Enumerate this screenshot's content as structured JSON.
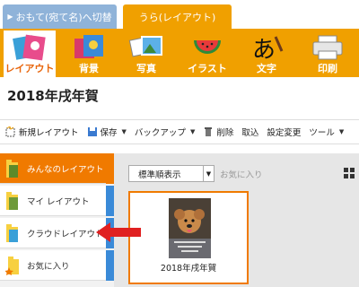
{
  "tabs": {
    "front_label": "おもて(宛て名)へ切替",
    "back_label": "うら(レイアウト)"
  },
  "categories": [
    {
      "label": "レイアウト",
      "active": true
    },
    {
      "label": "背景"
    },
    {
      "label": "写真"
    },
    {
      "label": "イラスト"
    },
    {
      "label": "文字"
    },
    {
      "label": "印刷"
    }
  ],
  "page_title": "2018年戌年賀",
  "toolbar": {
    "new_layout": "新規レイアウト",
    "save": "保存",
    "backup": "バックアップ",
    "delete": "削除",
    "import": "取込",
    "settings": "設定変更",
    "tools": "ツール"
  },
  "sidebar": {
    "items": [
      {
        "label": "みんなのレイアウト",
        "active": true
      },
      {
        "label": "マイ レイアウト"
      },
      {
        "label": "クラウドレイアウト"
      },
      {
        "label": "お気に入り"
      }
    ]
  },
  "content": {
    "sort_value": "標準順表示",
    "favorites_label": "お気に入り",
    "card_label": "2018年戌年賀"
  },
  "colors": {
    "accent": "#f0a000",
    "active": "#f07a00",
    "front_tab": "#8fb3d9",
    "arrow": "#e02020"
  }
}
